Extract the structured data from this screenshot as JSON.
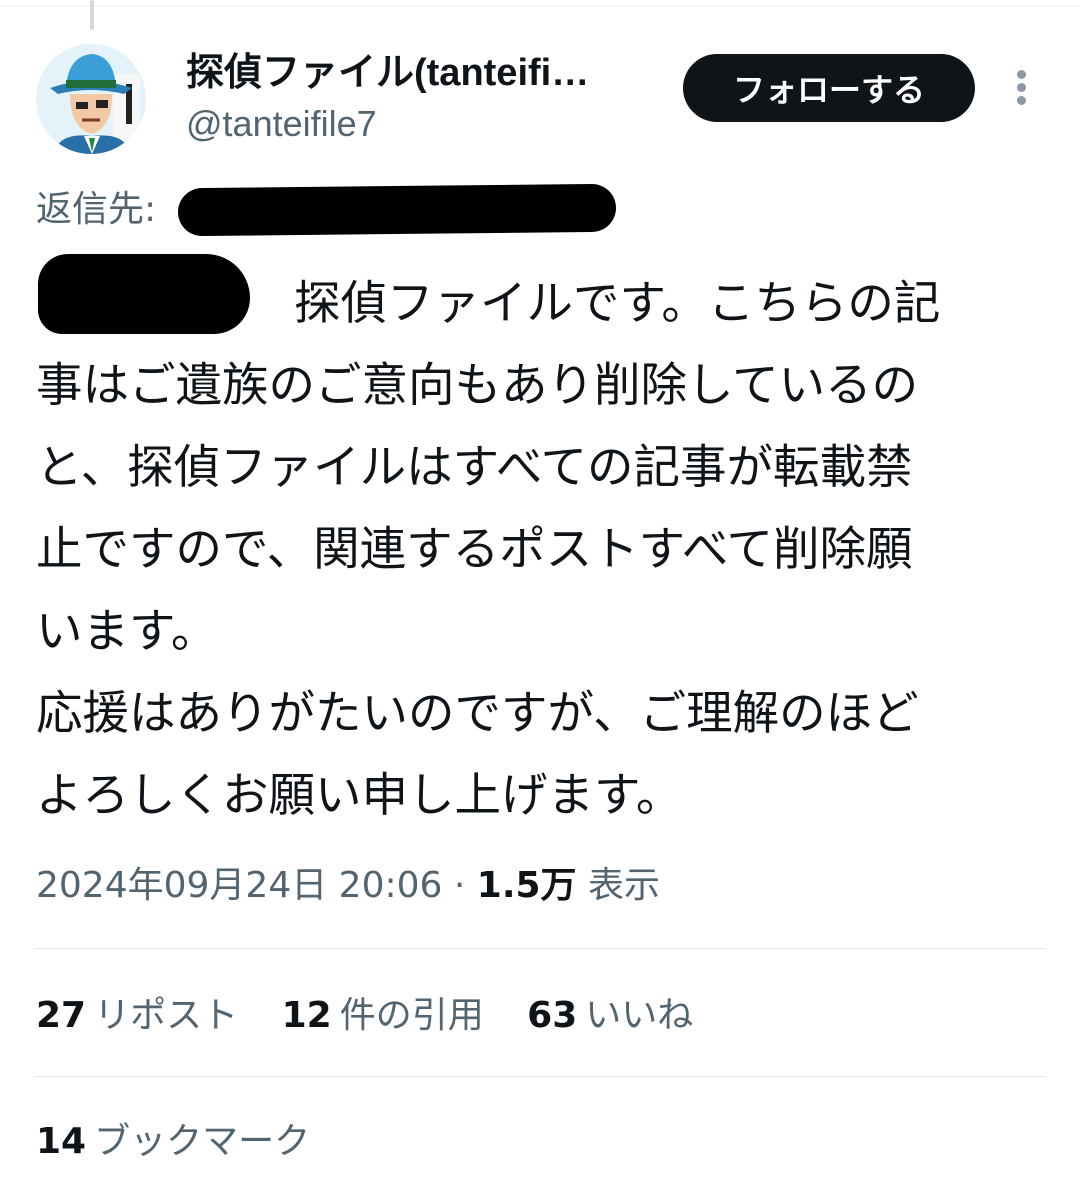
{
  "author": {
    "name": "探偵ファイル(tanteifi…",
    "handle": "@tanteifile7"
  },
  "follow_button": {
    "label": "フォローする"
  },
  "more_icon": "more-vertical-icon",
  "reply_to": {
    "label": "返信先:"
  },
  "tweet": {
    "lines": [
      "探偵ファイルです。こちらの記",
      "事はご遺族のご意向もあり削除しているの",
      "と、探偵ファイルはすべての記事が転載禁",
      "止ですので、関連するポストすべて削除願",
      "います。",
      "応援はありがたいのですが、ご理解のほど",
      "よろしくお願い申し上げます。"
    ]
  },
  "meta": {
    "timestamp": "2024年09月24日 20:06",
    "separator": " · ",
    "views_count": "1.5万",
    "views_label": "表示"
  },
  "stats": {
    "reposts": {
      "count": "27",
      "label": "リポスト"
    },
    "quotes": {
      "count": "12",
      "label": "件の引用"
    },
    "likes": {
      "count": "63",
      "label": "いいね"
    }
  },
  "bookmarks": {
    "count": "14",
    "label": "ブックマーク"
  },
  "colors": {
    "text_primary": "#0f1419",
    "text_secondary": "#536471",
    "button_bg": "#0f1419",
    "divider": "#e1e8ed"
  }
}
